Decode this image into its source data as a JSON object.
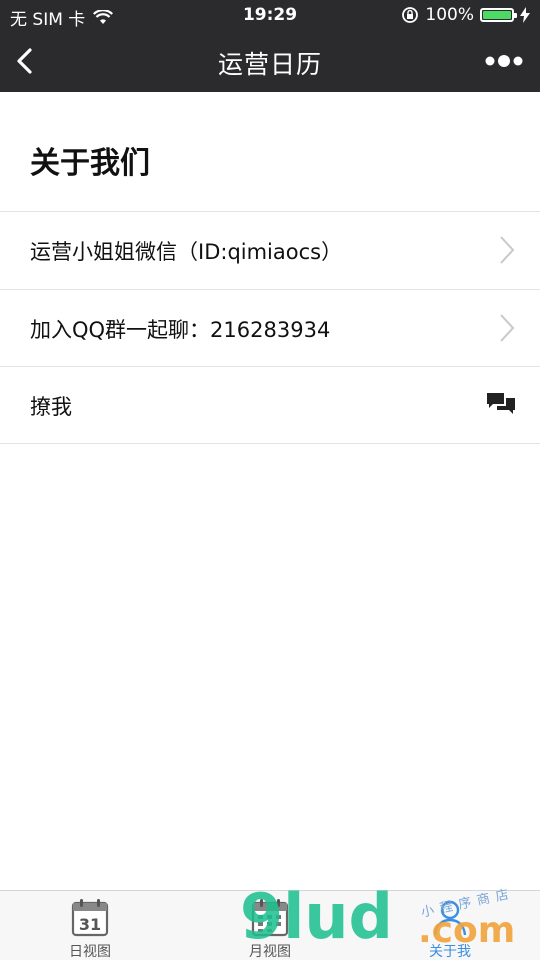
{
  "status_bar": {
    "carrier": "无 SIM 卡",
    "time": "19:29",
    "battery": "100%"
  },
  "nav": {
    "title": "运营日历",
    "back_icon": "chevron-left-icon",
    "more_icon": "more-dots-icon"
  },
  "section": {
    "title": "关于我们"
  },
  "rows": [
    {
      "label": "运营小姐姐微信（ID:qimiaocs）",
      "icon": "chevron-right-icon"
    },
    {
      "label": "加入QQ群一起聊：216283934",
      "icon": "chevron-right-icon"
    },
    {
      "label": "撩我",
      "icon": "chat-bubbles-icon"
    }
  ],
  "tabbar": {
    "tabs": [
      {
        "label": "日视图",
        "icon": "calendar-31-icon"
      },
      {
        "label": "月视图",
        "icon": "calendar-grid-icon"
      },
      {
        "label": "关于我",
        "icon": "person-icon",
        "active": true
      }
    ],
    "calendar_day": "31"
  },
  "watermark": {
    "brand": "9lud",
    "suffix": ".com",
    "dot": ".",
    "shop": "小程序商店"
  },
  "colors": {
    "nav_bg": "#2b2b2e",
    "tab_active": "#3a8fe0",
    "battery": "#4cd964"
  }
}
